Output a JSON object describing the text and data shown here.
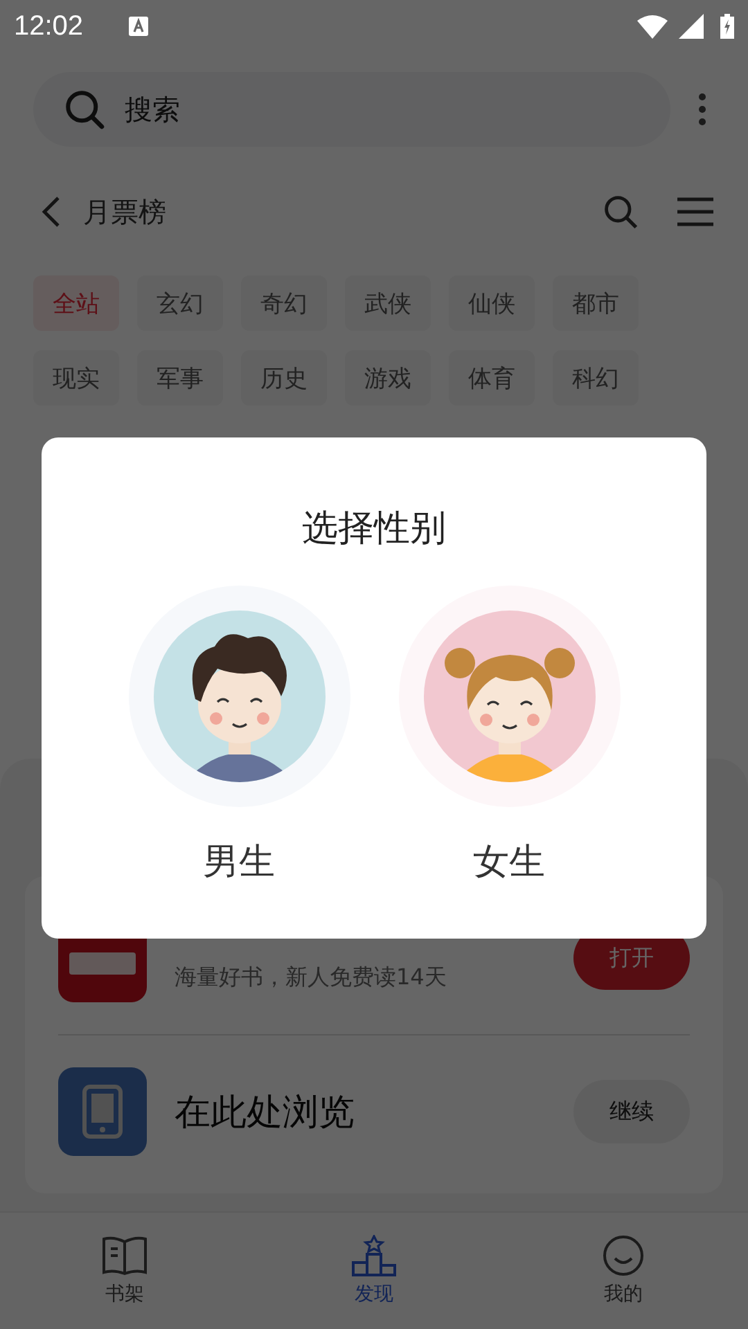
{
  "status_bar": {
    "time": "12:02"
  },
  "search": {
    "placeholder": "搜索"
  },
  "header": {
    "title": "月票榜"
  },
  "tags": [
    {
      "label": "全站",
      "selected": true
    },
    {
      "label": "玄幻",
      "selected": false
    },
    {
      "label": "奇幻",
      "selected": false
    },
    {
      "label": "武侠",
      "selected": false
    },
    {
      "label": "仙侠",
      "selected": false
    },
    {
      "label": "都市",
      "selected": false
    },
    {
      "label": "现实",
      "selected": false
    },
    {
      "label": "军事",
      "selected": false
    },
    {
      "label": "历史",
      "selected": false
    },
    {
      "label": "游戏",
      "selected": false
    },
    {
      "label": "体育",
      "selected": false
    },
    {
      "label": "科幻",
      "selected": false
    }
  ],
  "sheet": {
    "apps": [
      {
        "kind": "app",
        "subtitle": "海量好书，新人免费读14天",
        "action": "打开"
      },
      {
        "kind": "browser",
        "title": "在此处浏览",
        "action": "继续"
      }
    ]
  },
  "dialog": {
    "title": "选择性别",
    "options": [
      {
        "kind": "male",
        "label": "男生"
      },
      {
        "kind": "female",
        "label": "女生"
      }
    ]
  },
  "bottom_nav": [
    {
      "kind": "shelf",
      "label": "书架",
      "selected": false
    },
    {
      "kind": "discover",
      "label": "发现",
      "selected": true
    },
    {
      "kind": "me",
      "label": "我的",
      "selected": false
    }
  ]
}
